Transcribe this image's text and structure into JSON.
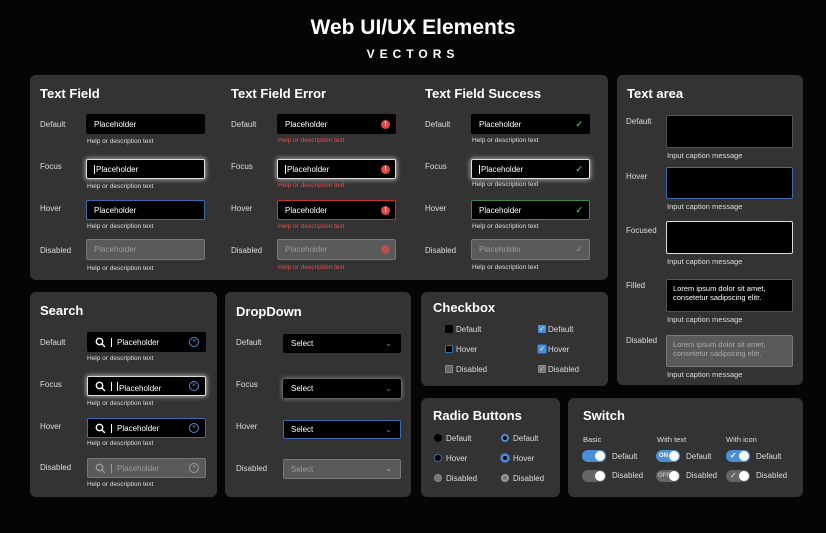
{
  "header": {
    "title": "Web UI/UX Elements",
    "subtitle": "VECTORS"
  },
  "states": {
    "default": "Default",
    "focus": "Focus",
    "hover": "Hover",
    "disabled": "Disabled",
    "focused": "Focused",
    "filled": "Filled"
  },
  "text_field": {
    "title": "Text Field",
    "placeholder": "Placeholder",
    "help": "Help or description text"
  },
  "text_field_error": {
    "title": "Text Field Error",
    "placeholder": "Placeholder",
    "help": "Help or description text"
  },
  "text_field_success": {
    "title": "Text Field Success",
    "placeholder": "Placeholder",
    "help": "Help or description text"
  },
  "text_area": {
    "title": "Text area",
    "caption": "Input caption message",
    "filled_text": "Lorem ipsum dolor sit amet, consetetur sadipscing elitr.",
    "disabled_text": "Lorem ipsum dolor sit amet, consetetur sadipscing elitr."
  },
  "search": {
    "title": "Search",
    "placeholder": "Placeholder",
    "help": "Help or description text"
  },
  "dropdown": {
    "title": "DropDown",
    "value": "Select"
  },
  "checkbox": {
    "title": "Checkbox"
  },
  "radio": {
    "title": "Radio Buttons"
  },
  "switch": {
    "title": "Switch",
    "basic": "Basic",
    "with_text": "With text",
    "with_icon": "With icon",
    "on_text": "ON",
    "off_text": "OFF"
  },
  "colors": {
    "accent": "#4a8fd8",
    "error": "#e04848",
    "success": "#4caf50",
    "panel": "#333333"
  }
}
